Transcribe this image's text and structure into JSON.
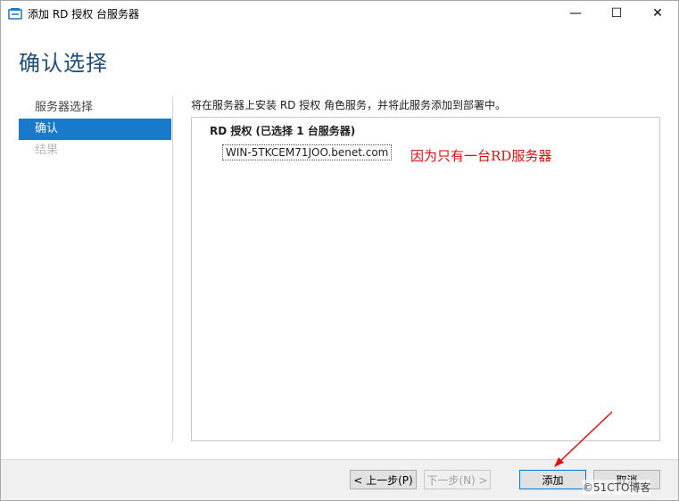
{
  "window": {
    "title": "添加 RD 授权 台服务器",
    "minimize_glyph": "—",
    "maximize_glyph": "☐",
    "close_glyph": "✕"
  },
  "page_title": "确认选择",
  "nav": {
    "items": [
      {
        "label": "服务器选择",
        "state": "normal"
      },
      {
        "label": "确认",
        "state": "active"
      },
      {
        "label": "结果",
        "state": "disabled"
      }
    ]
  },
  "content": {
    "intro": "将在服务器上安装 RD 授权 角色服务，并将此服务添加到部署中。",
    "role_title": "RD 授权  (已选择 1 台服务器)",
    "server_name": "WIN-5TKCEM71JOO.benet.com",
    "annotation": "因为只有一台RD服务器"
  },
  "buttons": {
    "prev": "< 上一步(P)",
    "next": "下一步(N) >",
    "add": "添加",
    "cancel": "取消"
  },
  "watermark": "©51CTO博客",
  "colors": {
    "title_blue": "#1e4e79",
    "nav_active": "#1979ca",
    "annotation_red": "#e01010"
  },
  "icons": {
    "app": "server-manager-icon",
    "arrow": "red-annotation-arrow"
  }
}
